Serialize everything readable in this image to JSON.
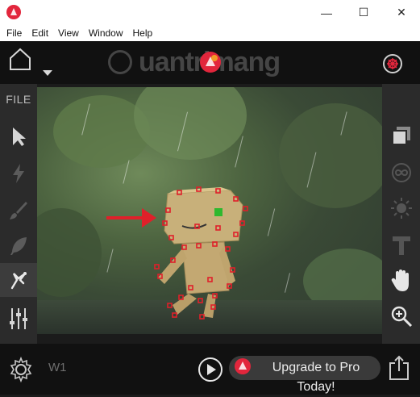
{
  "window": {
    "title": "",
    "min_glyph": "—",
    "max_glyph": "☐",
    "close_glyph": "✕"
  },
  "menu": {
    "items": [
      "File",
      "Edit",
      "View",
      "Window",
      "Help"
    ]
  },
  "header": {
    "watermark": "uantrimang"
  },
  "left_toolbar": {
    "file_label": "FILE",
    "tools": [
      "select-arrow-icon",
      "lightning-icon",
      "brush-icon",
      "feather-icon",
      "puppet-pin-icon",
      "sliders-icon"
    ],
    "active_tool": "puppet-pin-icon"
  },
  "right_toolbar": {
    "tools": [
      "layers-icon",
      "loop-icon",
      "brightness-icon",
      "text-icon",
      "hand-icon",
      "zoom-icon"
    ]
  },
  "bottom": {
    "layer_label": "W1",
    "upgrade_label_line1": "Upgrade to Pro",
    "upgrade_label_line2": "Today!"
  },
  "colors": {
    "accent": "#e2263c",
    "pin": "#e0202a",
    "pin_active": "#2eb82e"
  }
}
